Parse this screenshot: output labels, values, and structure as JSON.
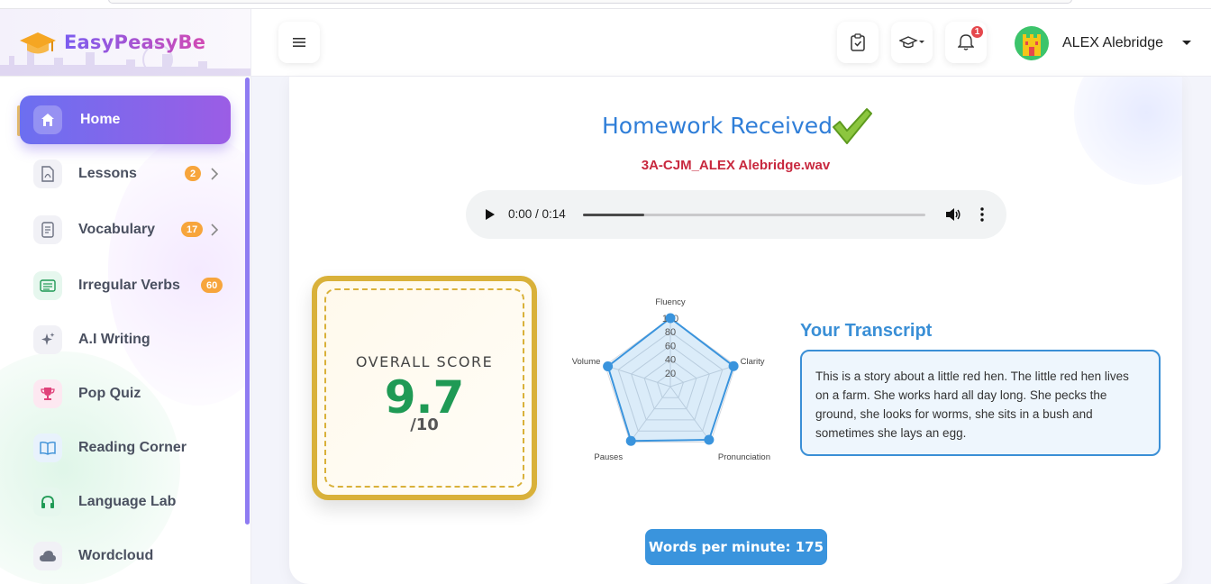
{
  "brand": {
    "name": "EasyPeasyBe"
  },
  "sidebar": {
    "items": [
      {
        "label": "Home",
        "icon": "home-icon",
        "active": true
      },
      {
        "label": "Lessons",
        "icon": "pdf-file-icon",
        "badge": "2"
      },
      {
        "label": "Vocabulary",
        "icon": "notes-list-icon",
        "badge": "17"
      },
      {
        "label": "Irregular Verbs",
        "icon": "list-icon",
        "badge": "60"
      },
      {
        "label": "A.I Writing",
        "icon": "sparkles-icon"
      },
      {
        "label": "Pop Quiz",
        "icon": "trophy-icon"
      },
      {
        "label": "Reading Corner",
        "icon": "open-book-icon"
      },
      {
        "label": "Language Lab",
        "icon": "headphones-icon"
      },
      {
        "label": "Wordcloud",
        "icon": "cloud-icon"
      }
    ]
  },
  "header": {
    "notifications_count": "1",
    "user_name": "ALEX Alebridge"
  },
  "main": {
    "title": "Homework Received",
    "filename": "3A-CJM_ALEX Alebridge.wav",
    "audio": {
      "time": "0:00 / 0:14",
      "progress": 0.18
    },
    "score": {
      "label": "OVERALL SCORE",
      "value": "9.7",
      "max": "/10"
    },
    "transcript_title": "Your Transcript",
    "transcript": "This is a story about a little red hen. The little red hen lives on a farm. She works hard all day long. She pecks the ground, she looks for worms, she sits in a bush and sometimes she lays an egg.",
    "wpm": "Words per minute: 175"
  },
  "chart_data": {
    "type": "radar",
    "axes": [
      "Fluency",
      "Clarity",
      "Pronunciation",
      "Pauses",
      "Volume"
    ],
    "values": [
      100,
      97,
      96,
      98,
      96
    ],
    "rmax": 100,
    "ticks": [
      "20",
      "40",
      "60",
      "80",
      "100"
    ],
    "colors": {
      "line": "#3a94dd",
      "fill": "rgba(58,148,221,0.18)"
    }
  }
}
